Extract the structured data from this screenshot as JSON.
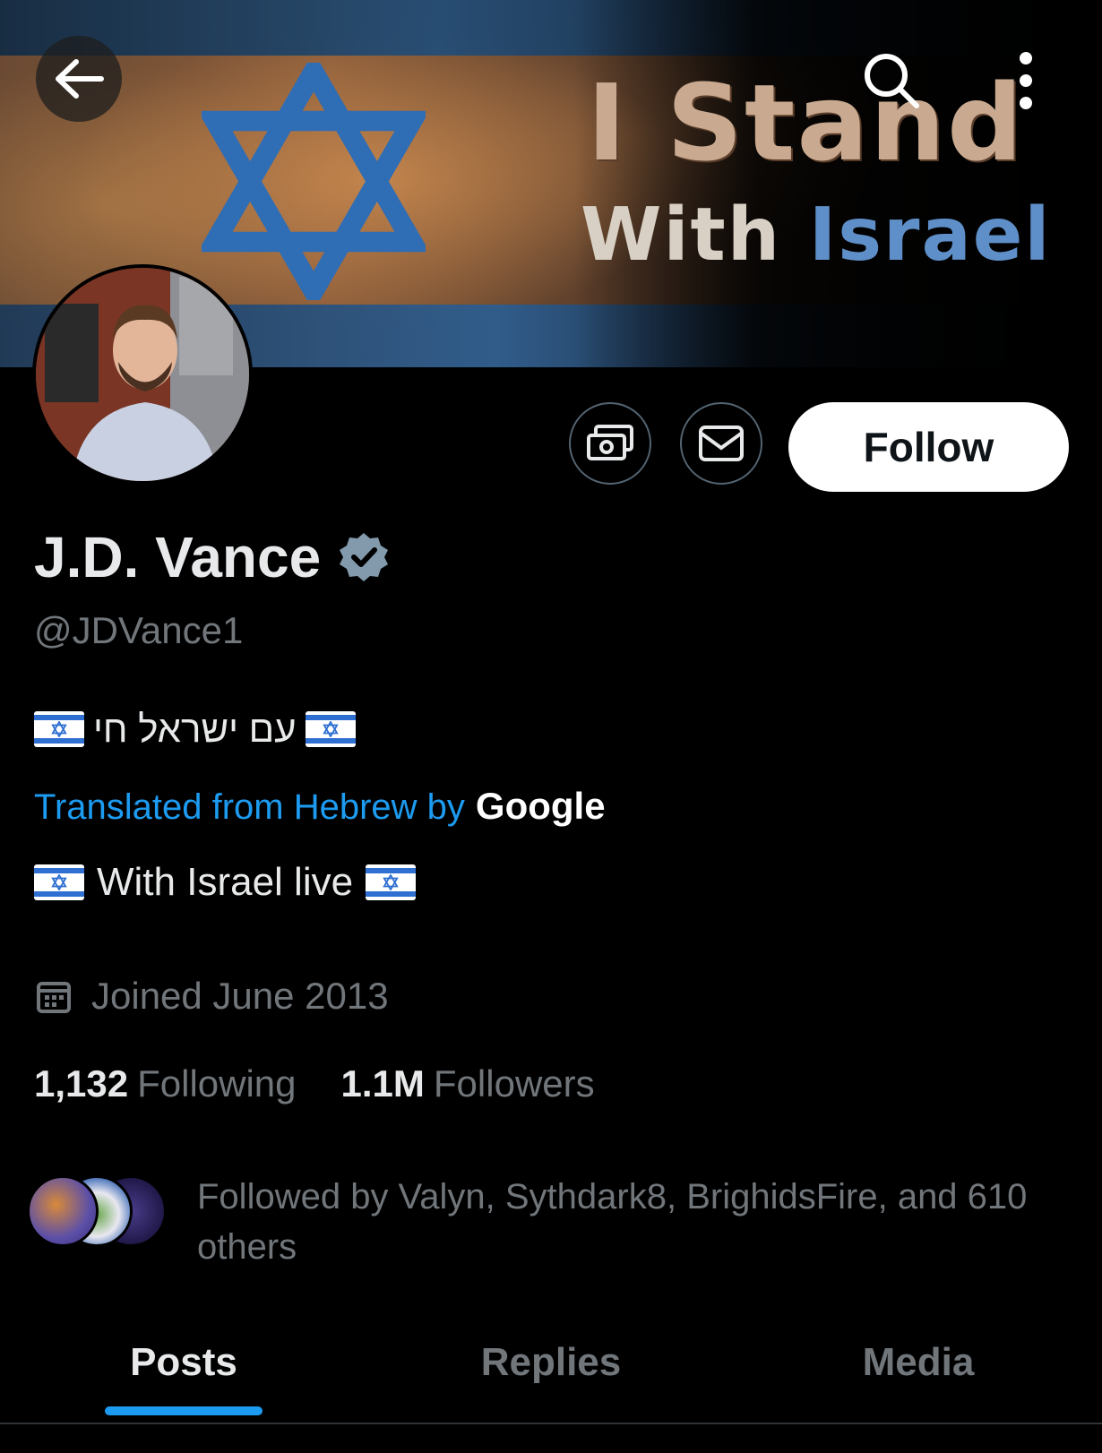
{
  "banner": {
    "slogan_line1": "I Stand",
    "slogan_line2_a": "With ",
    "slogan_line2_b": "Israel"
  },
  "nav": {
    "back_icon": "back-arrow-icon",
    "search_icon": "search-icon",
    "more_icon": "more-vertical-icon"
  },
  "actions": {
    "tip_icon": "money-icon",
    "message_icon": "mail-icon",
    "follow_label": "Follow"
  },
  "profile": {
    "name": "J.D. Vance",
    "verified": true,
    "handle": "@JDVance1",
    "bio_hebrew": "עם ישראל חי",
    "translated_label": "Translated from Hebrew by",
    "translator": "Google",
    "bio_translated": "With Israel live",
    "joined": "Joined June 2013",
    "following_count": "1,132",
    "following_label": "Following",
    "followers_count": "1.1M",
    "followers_label": "Followers",
    "followed_by": "Followed by Valyn, Sythdark8, BrighidsFire, and 610 others"
  },
  "tabs": [
    {
      "label": "Posts",
      "active": true
    },
    {
      "label": "Replies",
      "active": false
    },
    {
      "label": "Media",
      "active": false
    }
  ],
  "colors": {
    "accent": "#1d9bf0",
    "background": "#000000",
    "muted_text": "#71767b",
    "verified_badge": "#829aab"
  }
}
